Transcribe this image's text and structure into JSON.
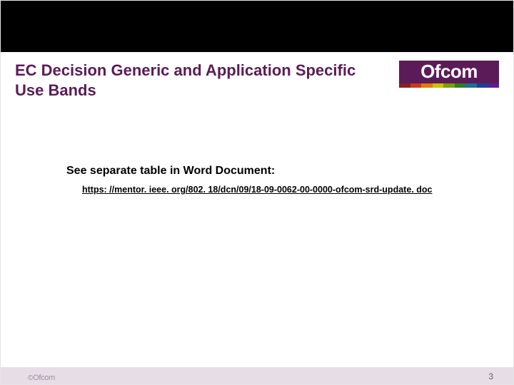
{
  "header": {
    "title": "EC Decision Generic and Application Specific Use Bands",
    "logo_text": "Ofcom"
  },
  "body": {
    "lead": "See separate table in Word Document:",
    "link_text": "https: //mentor. ieee. org/802. 18/dcn/09/18-09-0062-00-0000-ofcom-srd-update. doc"
  },
  "footer": {
    "copyright_symbol": "©",
    "copyright_text": "Ofcom",
    "page_number": "3"
  }
}
